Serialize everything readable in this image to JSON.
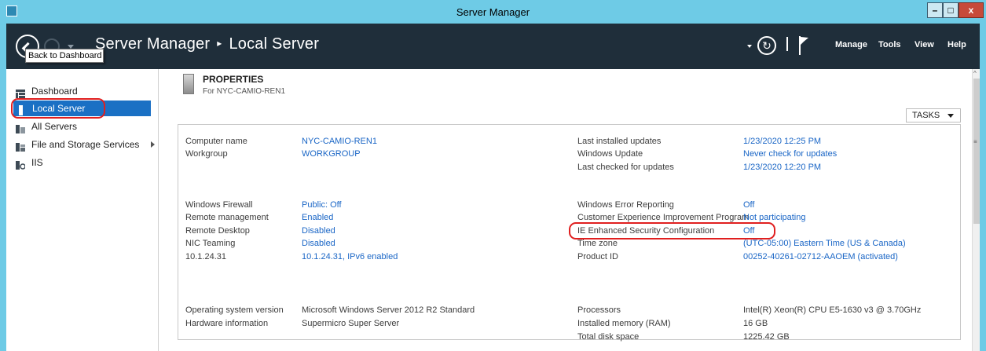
{
  "window": {
    "title": "Server Manager",
    "controls": {
      "minimize": "–",
      "maximize": "□",
      "close": "x"
    }
  },
  "header": {
    "back_tooltip": "Back to Dashboard",
    "breadcrumb_root": "Server Manager",
    "breadcrumb_separator": "▸",
    "breadcrumb_current": "Local Server",
    "refresh_glyph": "↻",
    "menus": {
      "manage": "Manage",
      "tools": "Tools",
      "view": "View",
      "help": "Help"
    }
  },
  "sidebar": {
    "items": [
      {
        "label": "Dashboard",
        "icon": "dashboard-icon"
      },
      {
        "label": "Local Server",
        "icon": "server-icon",
        "selected": true
      },
      {
        "label": "All Servers",
        "icon": "servers-icon"
      },
      {
        "label": "File and Storage Services",
        "icon": "storage-icon",
        "has_submenu": true
      },
      {
        "label": "IIS",
        "icon": "iis-icon"
      }
    ]
  },
  "properties": {
    "title": "PROPERTIES",
    "subtitle": "For NYC-CAMIO-REN1",
    "tasks_label": "TASKS",
    "group1_left": [
      {
        "label": "Computer name",
        "value": "NYC-CAMIO-REN1"
      },
      {
        "label": "Workgroup",
        "value": "WORKGROUP"
      }
    ],
    "group1_right": [
      {
        "label": "Last installed updates",
        "value": "1/23/2020 12:25 PM"
      },
      {
        "label": "Windows Update",
        "value": "Never check for updates"
      },
      {
        "label": "Last checked for updates",
        "value": "1/23/2020 12:20 PM"
      }
    ],
    "group2_left": [
      {
        "label": "Windows Firewall",
        "value": "Public: Off"
      },
      {
        "label": "Remote management",
        "value": "Enabled"
      },
      {
        "label": "Remote Desktop",
        "value": "Disabled"
      },
      {
        "label": "NIC Teaming",
        "value": "Disabled"
      },
      {
        "label": "10.1.24.31",
        "value": "10.1.24.31, IPv6 enabled"
      }
    ],
    "group2_right": [
      {
        "label": "Windows Error Reporting",
        "value": "Off"
      },
      {
        "label": "Customer Experience Improvement Program",
        "value": "Not participating"
      },
      {
        "label": "IE Enhanced Security Configuration",
        "value": "Off"
      },
      {
        "label": "Time zone",
        "value": "(UTC-05:00) Eastern Time (US & Canada)"
      },
      {
        "label": "Product ID",
        "value": "00252-40261-02712-AAOEM (activated)"
      }
    ],
    "group3_left": [
      {
        "label": "Operating system version",
        "value": "Microsoft Windows Server 2012 R2 Standard"
      },
      {
        "label": "Hardware information",
        "value": "Supermicro Super Server"
      }
    ],
    "group3_right": [
      {
        "label": "Processors",
        "value": "Intel(R) Xeon(R) CPU E5-1630 v3 @ 3.70GHz"
      },
      {
        "label": "Installed memory (RAM)",
        "value": "16 GB"
      },
      {
        "label": "Total disk space",
        "value": "1225.42 GB"
      }
    ]
  },
  "colors": {
    "titlebar": "#6ecbe6",
    "header": "#1f2e3a",
    "selection": "#1a70c4",
    "link": "#1a66c6",
    "highlight_ring": "#e01f1f"
  }
}
